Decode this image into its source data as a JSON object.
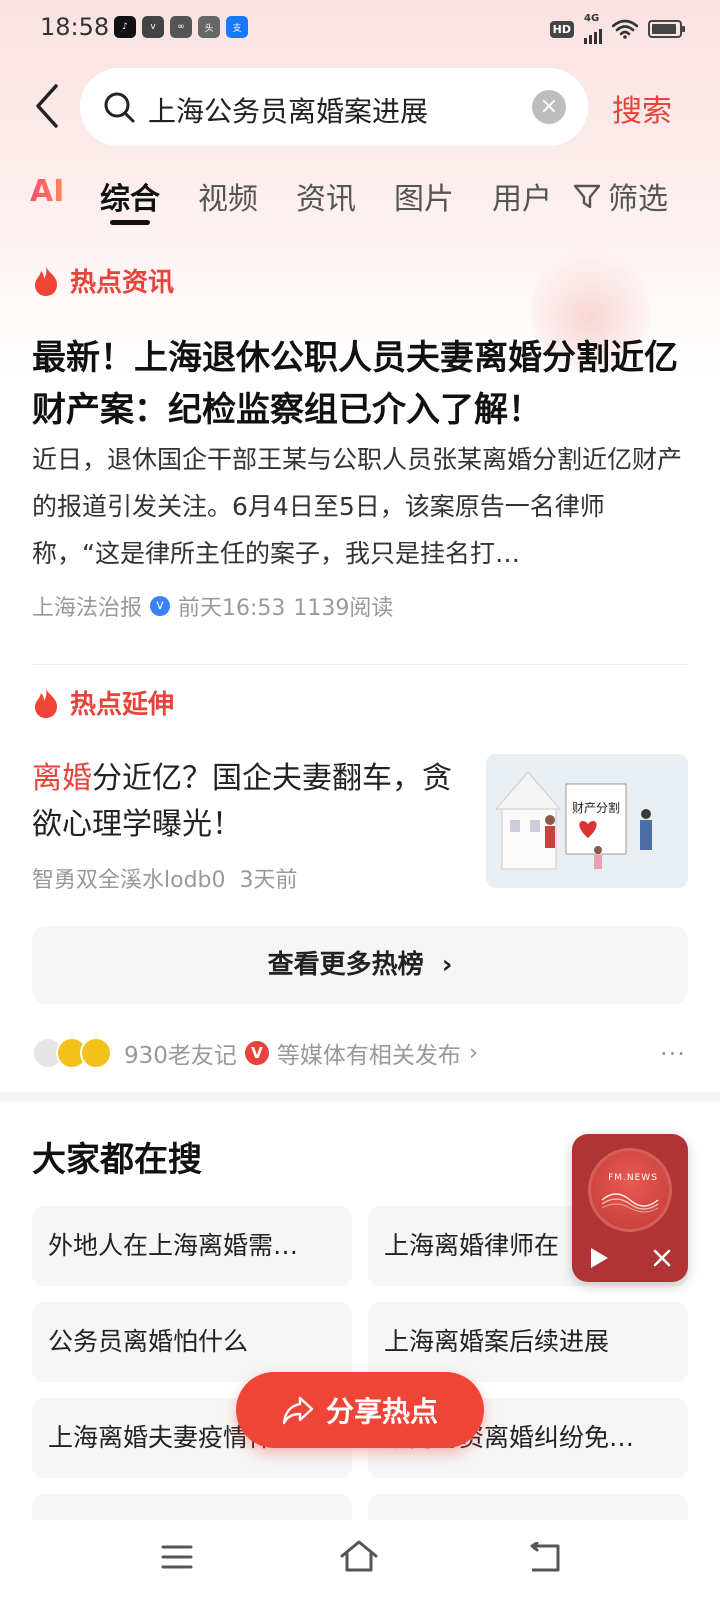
{
  "status_bar": {
    "time": "18:58",
    "network": "4G",
    "hd": "HD"
  },
  "search": {
    "query": "上海公务员离婚案进展",
    "submit_label": "搜索"
  },
  "tabs": [
    {
      "label": "AI"
    },
    {
      "label": "综合"
    },
    {
      "label": "视频"
    },
    {
      "label": "资讯"
    },
    {
      "label": "图片"
    },
    {
      "label": "用户"
    }
  ],
  "filter_label": "筛选",
  "hot_news": {
    "section_label": "热点资讯",
    "headline": "最新！上海退休公职人员夫妻离婚分割近亿财产案：纪检监察组已介入了解！",
    "summary": "近日，退休国企干部王某与公职人员张某离婚分割近亿财产的报道引发关注。6月4日至5日，该案原告一名律师称，“这是律所主任的案子，我只是挂名打…",
    "source": "上海法治报",
    "time": "前天16:53",
    "reads": "1139阅读"
  },
  "hot_extension": {
    "section_label": "热点延伸",
    "title_highlight": "离婚",
    "title_rest": "分近亿？国企夫妻翻车，贪欲心理学曝光！",
    "author": "智勇双全溪水lodb0",
    "time": "3天前",
    "thumb_caption": "财产分割"
  },
  "more_hot_label": "查看更多热榜",
  "media": {
    "name": "930老友记",
    "suffix": "等媒体有相关发布"
  },
  "everyone_searching": {
    "title": "大家都在搜",
    "items": [
      "外地人在上海离婚需…",
      "上海离婚律师在",
      "公务员离婚怕什么",
      "上海离婚案后续进展",
      "上海离婚夫妻疫情件",
      "婚内财资离婚纠纷免…"
    ]
  },
  "float_player": {
    "label": "FM.NEWS"
  },
  "share_label": "分享热点",
  "colors": {
    "accent": "#e8433a",
    "player": "#b03435"
  }
}
